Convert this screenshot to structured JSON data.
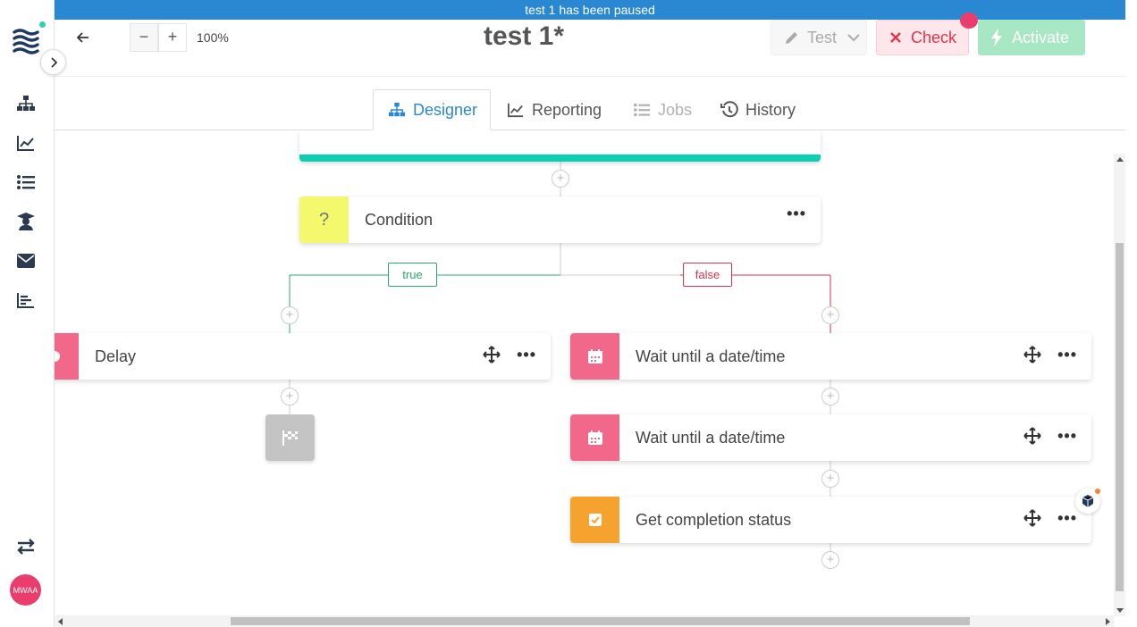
{
  "banner": {
    "text": "test 1 has been paused"
  },
  "header": {
    "title": "test 1*",
    "zoom": "100%",
    "zoom_out": "−",
    "zoom_in": "+",
    "test_label": "Test",
    "check_label": "Check",
    "activate_label": "Activate"
  },
  "tabs": [
    {
      "label": "Designer",
      "state": "active"
    },
    {
      "label": "Reporting",
      "state": "normal"
    },
    {
      "label": "Jobs",
      "state": "disabled"
    },
    {
      "label": "History",
      "state": "normal"
    }
  ],
  "sidebar": {
    "avatar": "MWAA",
    "items": [
      "org-chart-icon",
      "chart-line-icon",
      "list-icon",
      "graduate-icon",
      "envelope-icon",
      "bar-chart-icon"
    ],
    "bottom_icon": "swap-icon"
  },
  "flow": {
    "condition": {
      "label": "Condition",
      "icon": "?"
    },
    "branches": {
      "true_label": "true",
      "false_label": "false"
    },
    "true_branch": [
      {
        "label": "Delay",
        "icon": "clock-icon"
      }
    ],
    "false_branch": [
      {
        "label": "Wait until a date/time",
        "icon": "calendar-icon"
      },
      {
        "label": "Wait until a date/time",
        "icon": "calendar-icon"
      },
      {
        "label": "Get completion status",
        "icon": "check-square-icon"
      }
    ],
    "end_icon": "finish-flag-icon"
  },
  "colors": {
    "primary": "#2a88d3",
    "condition": "#f3f86d",
    "wait": "#f1688a",
    "status": "#f5a22f",
    "true": "#2aa86f",
    "false": "#d6334c",
    "teal": "#0acfb0"
  }
}
